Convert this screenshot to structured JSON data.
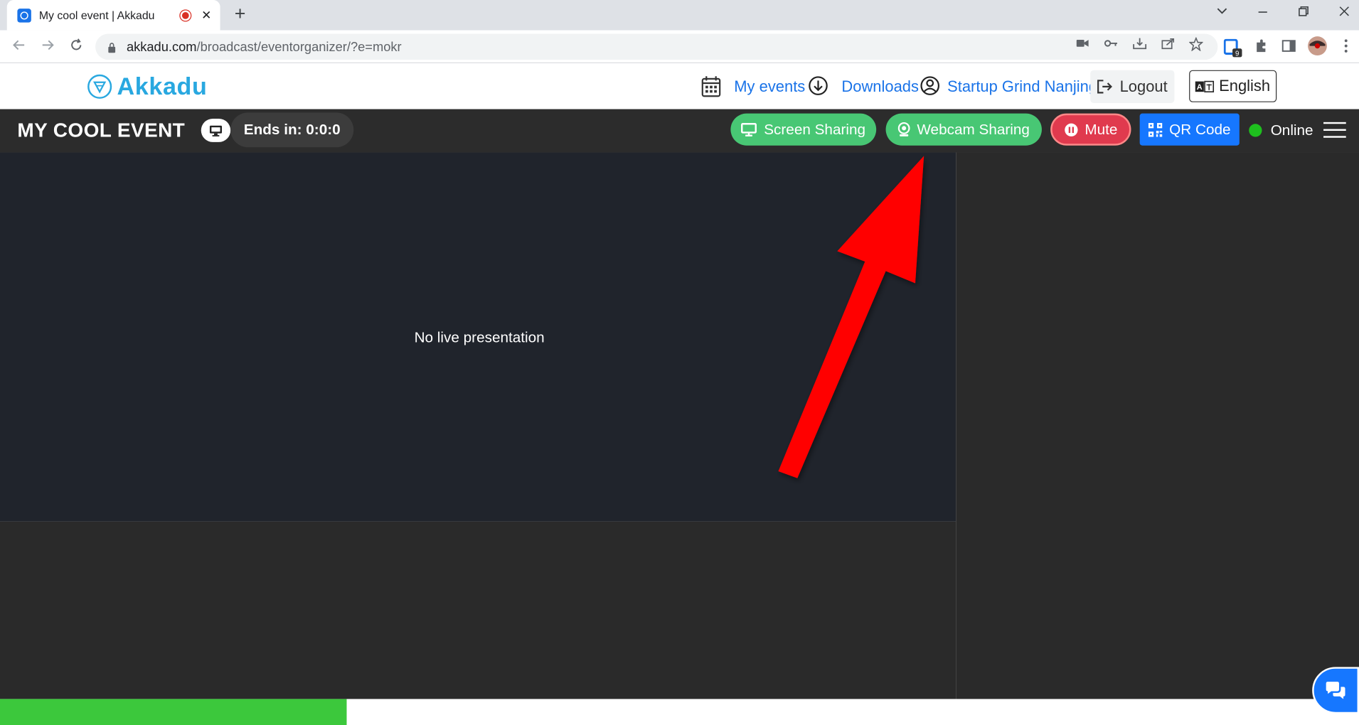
{
  "browser": {
    "tab_title": "My cool event | Akkadu",
    "tab_close": "✕",
    "new_tab": "+",
    "url_host": "akkadu.com",
    "url_path": "/broadcast/eventorganizer/?e=mokr",
    "extension_badge": "9"
  },
  "site": {
    "logo_text": "Akkadu",
    "nav": {
      "my_events": "My events",
      "downloads": "Downloads",
      "account": "Startup Grind Nanjing",
      "logout": "Logout",
      "language": "English"
    }
  },
  "event": {
    "title": "MY COOL EVENT",
    "timer": "Ends in: 0:0:0",
    "buttons": {
      "screen_sharing": "Screen Sharing",
      "webcam_sharing": "Webcam Sharing",
      "mute": "Mute",
      "qr_code": "QR Code"
    },
    "status": "Online",
    "stage_message": "No live presentation",
    "progress": 0.255
  },
  "colors": {
    "brand": "#29a8e0",
    "green": "#48c774",
    "red": "#e03a4e",
    "blue": "#1677ff",
    "online": "#1ec01e",
    "annotation_arrow": "#ff0000"
  },
  "icons": [
    "calendar-icon",
    "download-icon",
    "user-icon",
    "logout-icon",
    "language-icon",
    "monitor-icon",
    "webcam-icon",
    "pause-icon",
    "qr-icon",
    "menu-icon",
    "chat-icon"
  ]
}
